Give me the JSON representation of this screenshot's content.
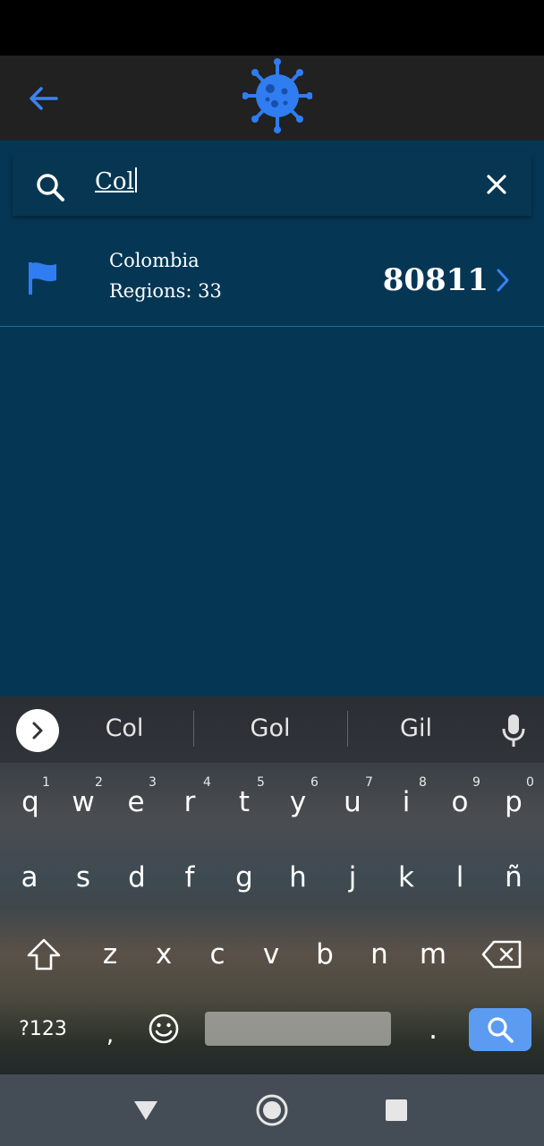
{
  "app": {
    "back_icon": "arrow-left-icon",
    "logo_icon": "virus-icon",
    "accent_color": "#3b82f6"
  },
  "search": {
    "value": "Col",
    "search_icon": "search-icon",
    "clear_icon": "close-icon"
  },
  "results": [
    {
      "name": "Colombia",
      "regions": "Regions: 33",
      "count": "80811",
      "icon": "flag-icon"
    }
  ],
  "keyboard": {
    "suggestions": [
      "Col",
      "Gol",
      "Gil"
    ],
    "row1": [
      "q",
      "w",
      "e",
      "r",
      "t",
      "y",
      "u",
      "i",
      "o",
      "p"
    ],
    "row1_hints": [
      "1",
      "2",
      "3",
      "4",
      "5",
      "6",
      "7",
      "8",
      "9",
      "0"
    ],
    "row2": [
      "a",
      "s",
      "d",
      "f",
      "g",
      "h",
      "j",
      "k",
      "l",
      "ñ"
    ],
    "row3": [
      "z",
      "x",
      "c",
      "v",
      "b",
      "n",
      "m"
    ],
    "symbols_label": "?123",
    "comma": ",",
    "period": "."
  }
}
